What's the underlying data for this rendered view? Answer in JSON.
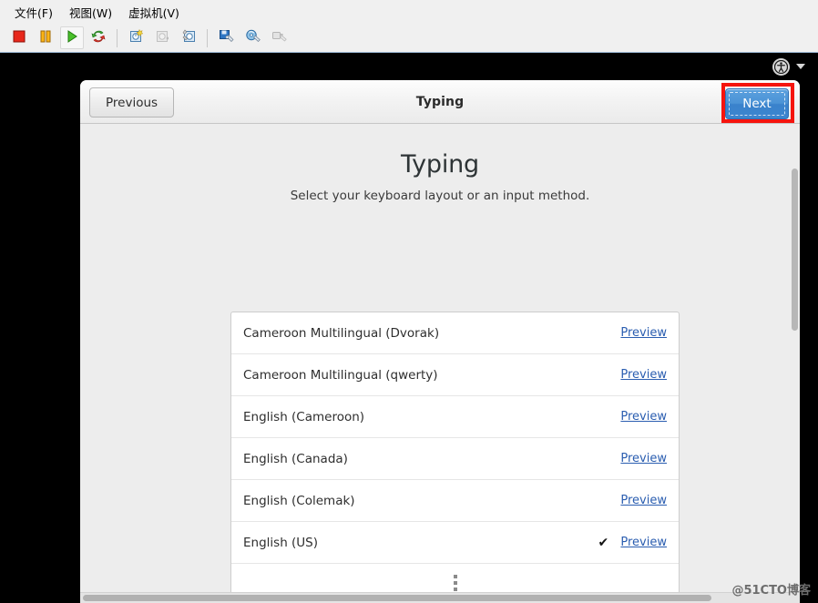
{
  "host": {
    "menus": [
      {
        "label": "文件(F)",
        "name": "menu-file"
      },
      {
        "label": "视图(W)",
        "name": "menu-view"
      },
      {
        "label": "虚拟机(V)",
        "name": "menu-virtual-machine"
      }
    ],
    "toolbar": [
      {
        "name": "stop-icon",
        "title": "停止"
      },
      {
        "name": "pause-icon",
        "title": "暂停"
      },
      {
        "name": "play-icon",
        "title": "播放"
      },
      {
        "name": "reset-icon",
        "title": "重置"
      },
      {
        "name": "snapshot-icon",
        "title": "快照"
      },
      {
        "name": "revert-snapshot-icon",
        "title": "恢复快照"
      },
      {
        "name": "snapshot-manager-icon",
        "title": "快照管理器"
      },
      {
        "name": "settings-icon",
        "title": "虚拟机设置"
      },
      {
        "name": "cd-settings-icon",
        "title": "CD/DVD 设置"
      },
      {
        "name": "usb-settings-icon",
        "title": "USB 设置"
      }
    ]
  },
  "topbar": {
    "accessibility_icon": "universal-access-icon",
    "dropdown_icon": "chevron-down-icon"
  },
  "window": {
    "header_title": "Typing",
    "previous_label": "Previous",
    "next_label": "Next"
  },
  "page": {
    "title": "Typing",
    "subtitle": "Select your keyboard layout or an input method.",
    "preview_label": "Preview",
    "check_glyph": "✔",
    "layouts": [
      {
        "name": "Cameroon Multilingual (Dvorak)",
        "selected": false
      },
      {
        "name": "Cameroon Multilingual (qwerty)",
        "selected": false
      },
      {
        "name": "English (Cameroon)",
        "selected": false
      },
      {
        "name": "English (Canada)",
        "selected": false
      },
      {
        "name": "English (Colemak)",
        "selected": false
      },
      {
        "name": "English (US)",
        "selected": true
      }
    ],
    "more_indicator": "more-options-icon"
  },
  "colors": {
    "next_accent": "#3c85ce",
    "highlight_box": "#f5140e",
    "link": "#2a5db0",
    "window_bg": "#ededed"
  },
  "watermark": "@51CTO博客"
}
